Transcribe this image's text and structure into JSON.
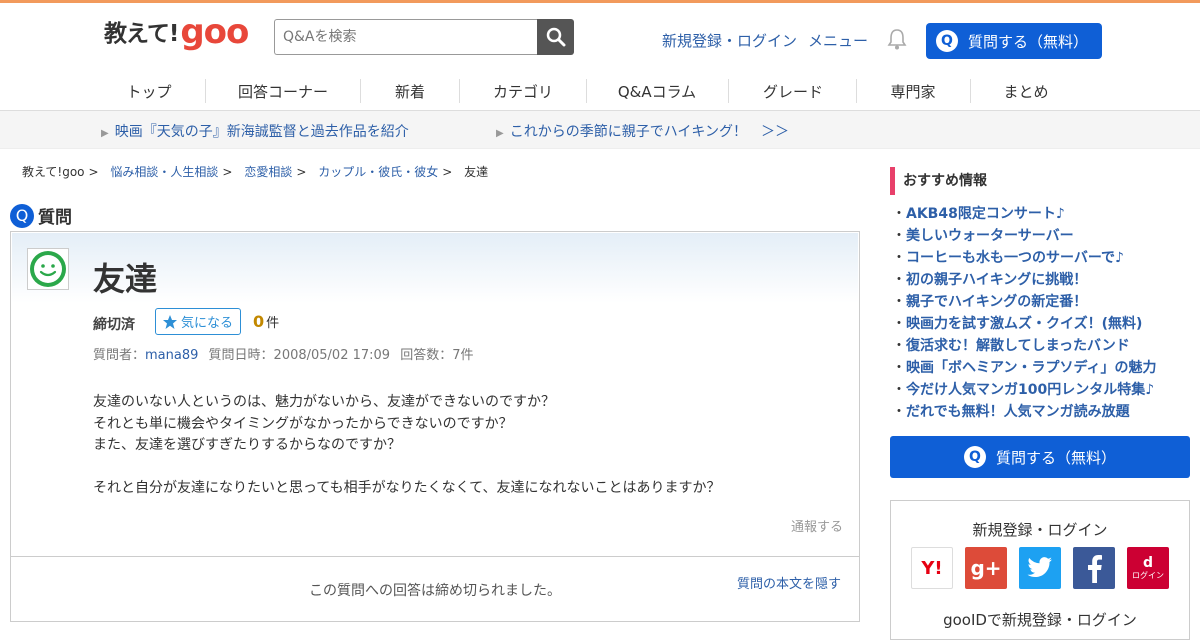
{
  "header": {
    "logo_text": "教えて!",
    "logo_brand": "goo",
    "search_placeholder": "Q&Aを検索",
    "signup_login": "新規登録・ログイン",
    "menu": "メニュー",
    "ask_button": "質問する（無料）"
  },
  "nav": [
    "トップ",
    "回答コーナー",
    "新着",
    "カテゴリ",
    "Q&Aコラム",
    "グレード",
    "専門家",
    "まとめ"
  ],
  "promo": {
    "item1": "映画『天気の子』新海誠監督と過去作品を紹介",
    "item2": "これからの季節に親子でハイキング！　＞＞"
  },
  "breadcrumb": [
    "教えて!goo",
    "悩み相談・人生相談",
    "恋愛相談",
    "カップル・彼氏・彼女",
    "友達"
  ],
  "question": {
    "label": "質問",
    "q_icon": "Q",
    "title": "友達",
    "status": "締切済",
    "fav_label": "気になる",
    "fav_count": "0",
    "fav_unit": "件",
    "asker_label": "質問者：",
    "asker": "mana89",
    "date": "質問日時：2008/05/02 17:09",
    "answers": "回答数：7件",
    "body": [
      "友達のいない人というのは、魅力がないから、友達ができないのですか？",
      "それとも単に機会やタイミングがなかったからできないのですか？",
      "また、友達を選びすぎたりするからなのですか？",
      "",
      "それと自分が友達になりたいと思っても相手がなりたくなくて、友達になれないことはありますか？"
    ],
    "report": "通報する",
    "closed_message": "この質問への回答は締め切られました。",
    "hide_body": "質問の本文を隠す"
  },
  "sidebar": {
    "title": "おすすめ情報",
    "items": [
      "AKB48限定コンサート♪",
      "美しいウォーターサーバー",
      "コーヒーも水も一つのサーバーで♪",
      "初の親子ハイキングに挑戦！",
      "親子でハイキングの新定番！",
      "映画力を試す激ムズ・クイズ！(無料)",
      "復活求む！解散してしまったバンド",
      "映画「ボヘミアン・ラプソディ」の魅力",
      "今だけ人気マンガ100円レンタル特集♪",
      "だれでも無料！人気マンガ読み放題"
    ],
    "ask_button": "質問する（無料）",
    "login_title": "新規登録・ログイン",
    "gooid": "gooIDで新規登録・ログイン",
    "sns": {
      "yahoo": "Y!",
      "google": "g+",
      "docomo": "ログイン"
    }
  },
  "colors": {
    "accent_orange": "#f29a5c",
    "primary_blue": "#0f5fd6",
    "link_blue": "#2d5fa8",
    "sidebar_accent": "#e8406a"
  }
}
